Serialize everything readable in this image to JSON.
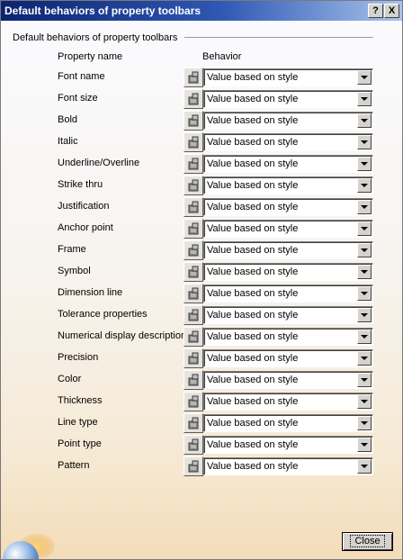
{
  "window": {
    "title": "Default behaviors of property toolbars",
    "help_label": "?",
    "close_label": "X"
  },
  "group": {
    "title": "Default behaviors of property toolbars",
    "col_property": "Property name",
    "col_behavior": "Behavior"
  },
  "rows": [
    {
      "label": "Font name",
      "value": "Value based on style"
    },
    {
      "label": "Font size",
      "value": "Value based on style"
    },
    {
      "label": "Bold",
      "value": "Value based on style"
    },
    {
      "label": "Italic",
      "value": "Value based on style"
    },
    {
      "label": "Underline/Overline",
      "value": "Value based on style"
    },
    {
      "label": "Strike thru",
      "value": "Value based on style"
    },
    {
      "label": "Justification",
      "value": "Value based on style"
    },
    {
      "label": "Anchor point",
      "value": "Value based on style"
    },
    {
      "label": "Frame",
      "value": "Value based on style"
    },
    {
      "label": "Symbol",
      "value": "Value based on style"
    },
    {
      "label": "Dimension line",
      "value": "Value based on style"
    },
    {
      "label": "Tolerance properties",
      "value": "Value based on style"
    },
    {
      "label": "Numerical display description",
      "value": "Value based on style"
    },
    {
      "label": "Precision",
      "value": "Value based on style"
    },
    {
      "label": "Color",
      "value": "Value based on style"
    },
    {
      "label": "Thickness",
      "value": "Value based on style"
    },
    {
      "label": "Line type",
      "value": "Value based on style"
    },
    {
      "label": "Point type",
      "value": "Value based on style"
    },
    {
      "label": "Pattern",
      "value": "Value based on style"
    }
  ],
  "footer": {
    "close_button_label": "Close"
  },
  "icons": {
    "row_icon": "style-stamp-icon",
    "corner_logo": "globe-logo-icon"
  }
}
